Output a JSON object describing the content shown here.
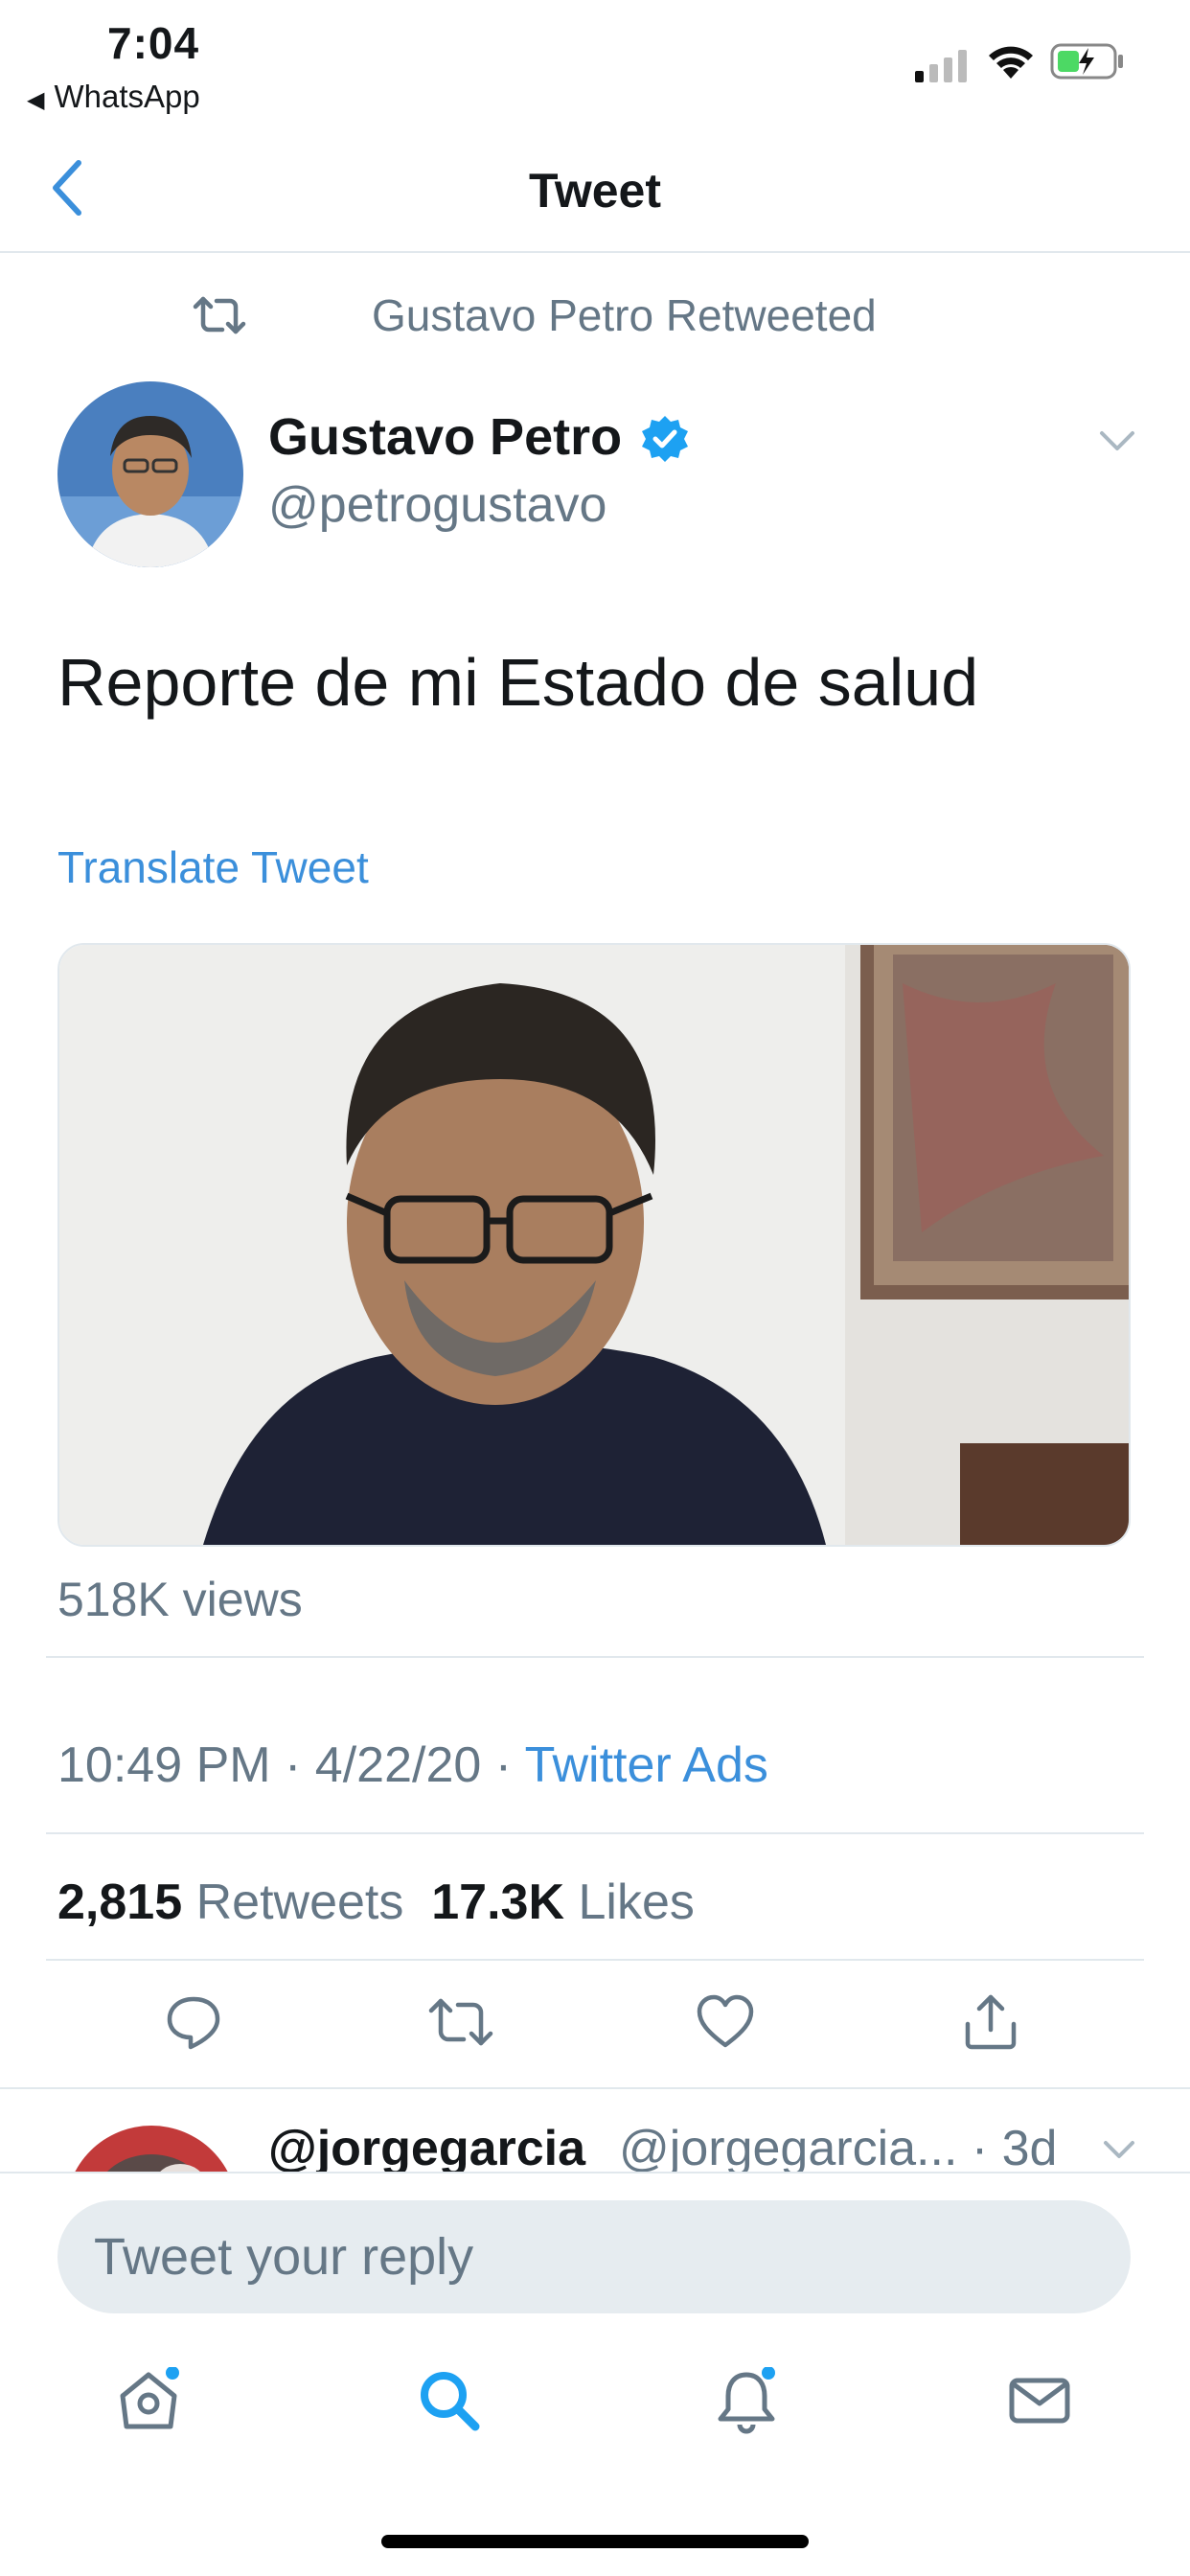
{
  "status_bar": {
    "time": "7:04",
    "back_app": "WhatsApp"
  },
  "nav": {
    "title": "Tweet"
  },
  "retweet_context": "Gustavo Petro Retweeted",
  "tweet": {
    "author_name": "Gustavo Petro",
    "author_handle": "@petrogustavo",
    "verified": true,
    "text": "Reporte de mi Estado de salud",
    "translate_label": "Translate Tweet",
    "media_type": "video",
    "views": "518K views",
    "time": "10:49 PM",
    "date": "4/22/20",
    "source": "Twitter Ads",
    "retweets_count": "2,815",
    "retweets_label": "Retweets",
    "likes_count": "17.3K",
    "likes_label": "Likes"
  },
  "actions": [
    "reply-icon",
    "retweet-icon",
    "like-icon",
    "share-icon"
  ],
  "reply_preview": {
    "name": "@jorgegarcia",
    "handle_time": "@jorgegarcia... · 3d"
  },
  "compose": {
    "placeholder": "Tweet your reply"
  },
  "tabbar": [
    "home-icon",
    "search-icon",
    "notifications-icon",
    "messages-icon"
  ],
  "colors": {
    "accent": "#1da1f2",
    "link": "#3b8fdb",
    "muted": "#657786",
    "divider": "#e1e8ed"
  }
}
